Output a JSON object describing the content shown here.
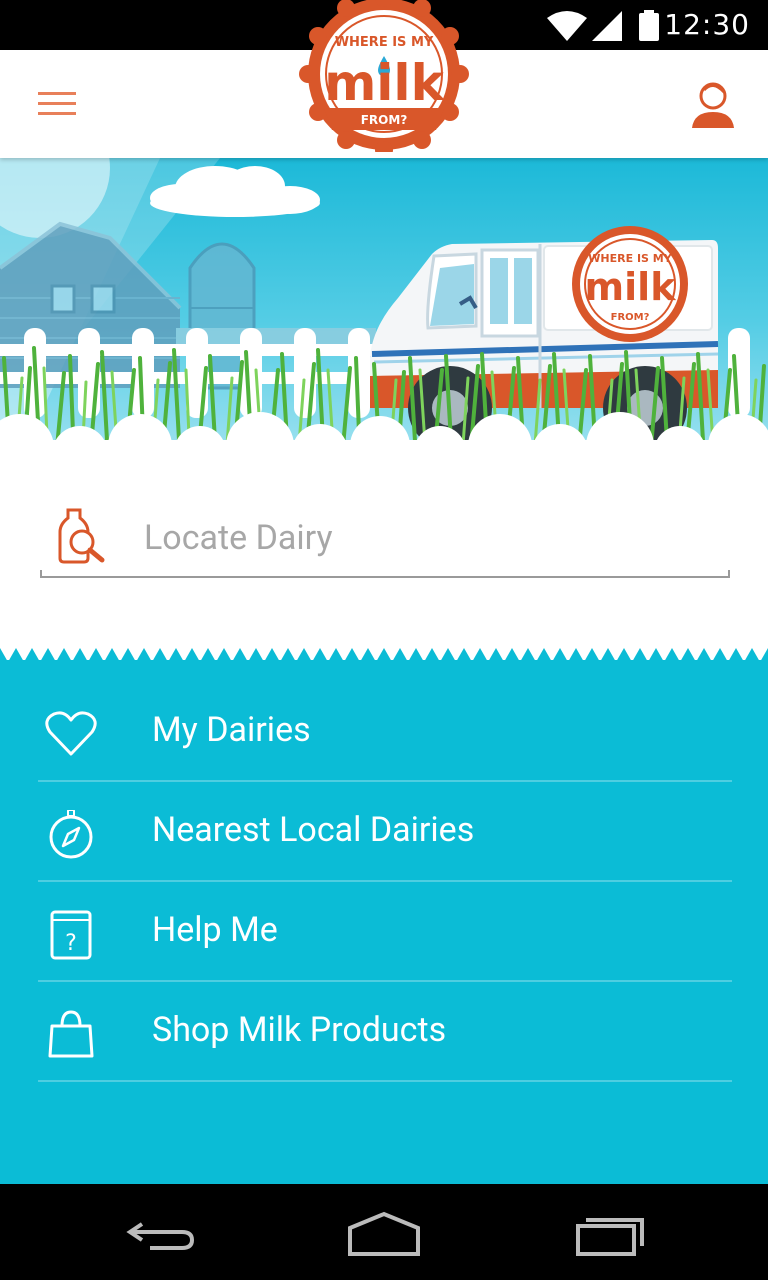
{
  "status_bar": {
    "time": "12:30",
    "icons": [
      "wifi-icon",
      "signal-icon",
      "battery-icon"
    ]
  },
  "app_bar": {
    "menu_icon": "hamburger-menu-icon",
    "profile_icon": "user-profile-icon",
    "logo": {
      "top_text": "WHERE IS MY",
      "main_text": "milk",
      "bottom_text": "FROM?"
    }
  },
  "hero": {
    "truck_logo": {
      "top_text": "WHERE IS MY",
      "main_text": "milk",
      "bottom_text": "FROM?"
    }
  },
  "search": {
    "icon": "milk-bottle-search-icon",
    "placeholder": "Locate Dairy",
    "value": ""
  },
  "menu": {
    "items": [
      {
        "label": "My Dairies",
        "icon": "heart-icon"
      },
      {
        "label": "Nearest Local Dairies",
        "icon": "compass-icon"
      },
      {
        "label": "Help Me",
        "icon": "help-book-icon"
      },
      {
        "label": "Shop Milk Products",
        "icon": "shopping-bag-icon"
      }
    ]
  },
  "nav_bar": {
    "icons": [
      "back-icon",
      "home-icon",
      "recents-icon"
    ]
  },
  "colors": {
    "brand_orange": "#d9572a",
    "accent_cyan": "#0bbcd6",
    "white": "#ffffff"
  }
}
